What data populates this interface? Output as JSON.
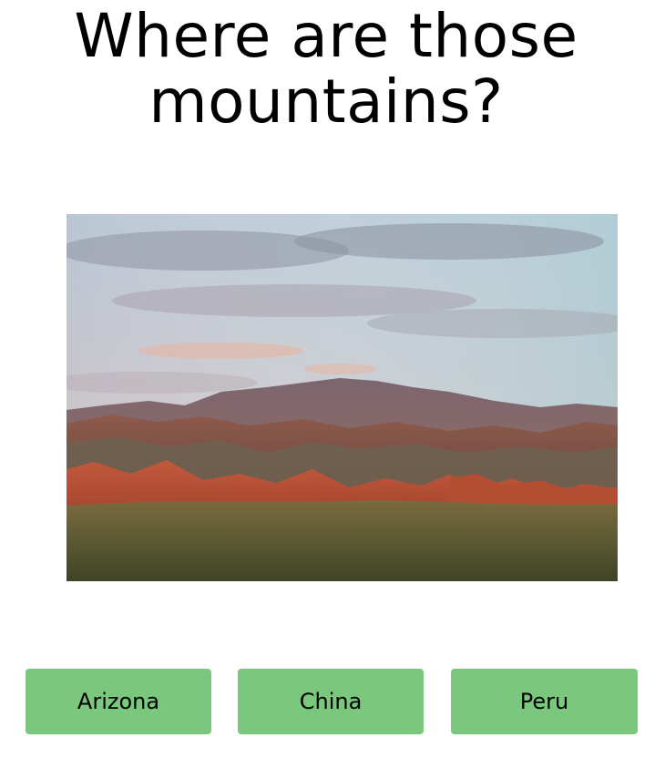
{
  "quiz": {
    "question_line1": "Where are those",
    "question_line2": "mountains?",
    "answers": [
      {
        "label": "Arizona"
      },
      {
        "label": "China"
      },
      {
        "label": "Peru"
      }
    ]
  },
  "colors": {
    "background": "#ffffff",
    "answer_button": "#7ac77d",
    "text": "#000000"
  }
}
